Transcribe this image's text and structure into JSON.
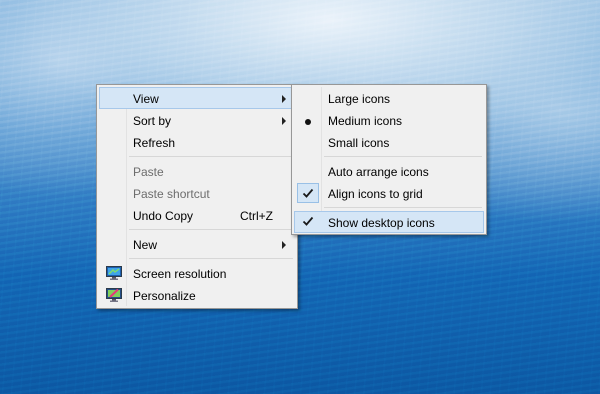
{
  "context_menu": {
    "items": [
      {
        "label": "View"
      },
      {
        "label": "Sort by"
      },
      {
        "label": "Refresh"
      },
      {
        "label": "Paste"
      },
      {
        "label": "Paste shortcut"
      },
      {
        "label": "Undo Copy",
        "shortcut": "Ctrl+Z"
      },
      {
        "label": "New"
      },
      {
        "label": "Screen resolution",
        "icon": "screen-resolution-icon"
      },
      {
        "label": "Personalize",
        "icon": "personalize-icon"
      }
    ]
  },
  "view_submenu": {
    "items": [
      {
        "label": "Large icons"
      },
      {
        "label": "Medium icons",
        "selected": true
      },
      {
        "label": "Small icons"
      },
      {
        "label": "Auto arrange icons",
        "checked": false
      },
      {
        "label": "Align icons to grid",
        "checked": true
      },
      {
        "label": "Show desktop icons",
        "checked": true
      }
    ]
  },
  "colors": {
    "menu_background": "#f0f0f0",
    "highlight": "#d5e6f6",
    "highlight_border": "#a7c8ea",
    "disabled_text": "#6d6d6d"
  }
}
